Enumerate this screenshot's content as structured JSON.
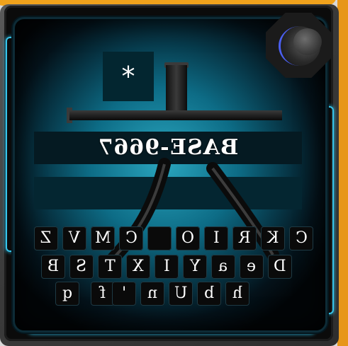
{
  "title": "BASE-9667",
  "star_key": "*",
  "keyboard": {
    "row1": [
      "Z",
      "V",
      "M",
      "C",
      "",
      "O",
      "I",
      "R",
      "K",
      "C"
    ],
    "row2": [
      "B",
      "S",
      "T",
      "X",
      "I",
      "Y",
      "a",
      "e",
      "D"
    ],
    "row3": [
      "q",
      "f",
      "'",
      "n",
      "U",
      "b",
      "h"
    ]
  },
  "colors": {
    "accent": "#36c4ea",
    "frame_orange": "#f0a21c",
    "plate_center": "#2aa6bf"
  }
}
